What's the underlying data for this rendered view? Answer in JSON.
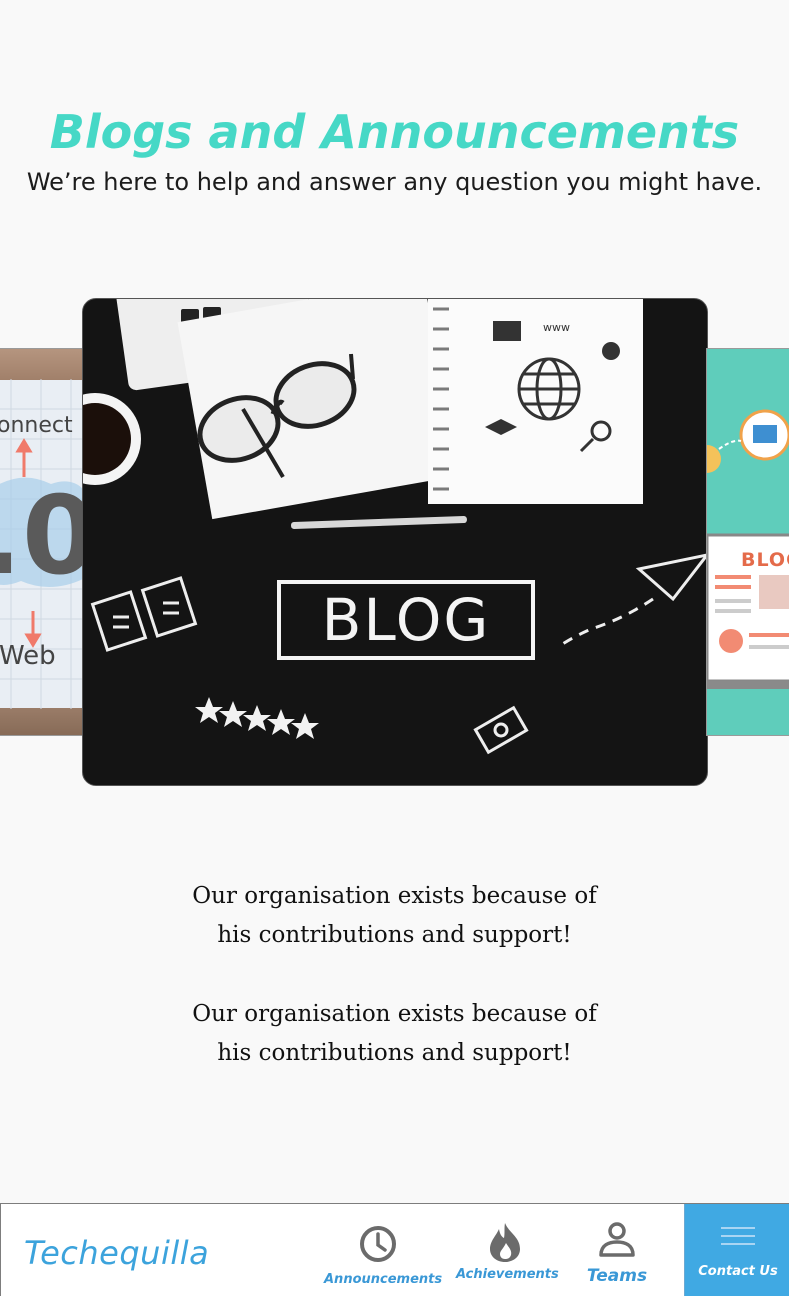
{
  "header": {
    "title": "Blogs and Announcements",
    "subtitle": "We’re here to help and answer any question you might have."
  },
  "carousel": {
    "main_slide": {
      "image_label": "BLOG"
    },
    "left_slide": {
      "text_top": "onnect",
      "text_big": ".0",
      "text_bottom": "Web"
    },
    "right_slide": {
      "text": "BLOG"
    }
  },
  "content": {
    "quotes": [
      "Our organisation exists because of his contributions and support!",
      "Our organisation exists because of his contributions and support!"
    ]
  },
  "bottom_nav": {
    "brand": "Techequilla",
    "items": [
      {
        "label": "Announcements",
        "icon": "clock-icon"
      },
      {
        "label": "Achievements",
        "icon": "flame-icon"
      },
      {
        "label": "Teams",
        "icon": "person-icon"
      },
      {
        "label": "Contact Us",
        "icon": "menu-icon"
      }
    ]
  },
  "colors": {
    "accent_teal": "#46d8c6",
    "brand_blue": "#3ca3dc",
    "contact_bg": "#40a9e3"
  }
}
